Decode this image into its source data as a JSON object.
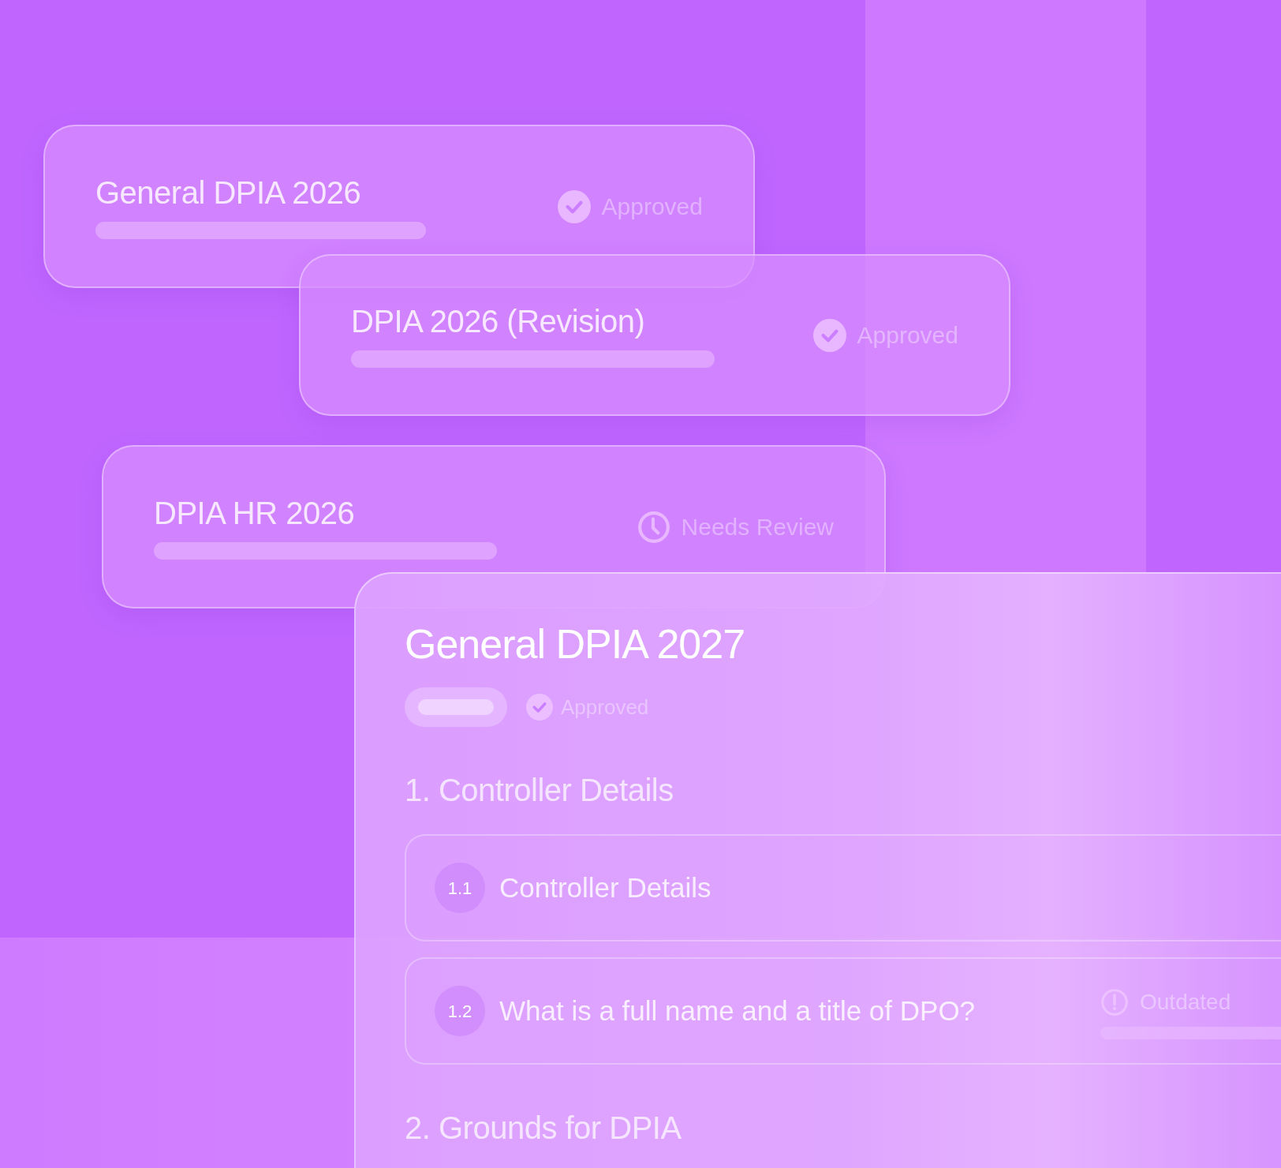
{
  "cards": [
    {
      "title": "General DPIA 2026",
      "status": {
        "kind": "approved",
        "label": "Approved"
      }
    },
    {
      "title": "DPIA 2026 (Revision)",
      "status": {
        "kind": "approved",
        "label": "Approved"
      }
    },
    {
      "title": "DPIA HR 2026",
      "status": {
        "kind": "review",
        "label": "Needs Review"
      }
    }
  ],
  "detail": {
    "title": "General DPIA 2027",
    "status": {
      "kind": "approved",
      "label": "Approved"
    },
    "sections": [
      {
        "title": "1. Controller Details",
        "items": [
          {
            "number": "1.1",
            "text": "Controller Details"
          },
          {
            "number": "1.2",
            "text": "What is a full name and a title of DPO?",
            "status": {
              "kind": "outdated",
              "label": "Outdated"
            }
          }
        ]
      },
      {
        "title": "2. Grounds for DPIA"
      }
    ]
  }
}
